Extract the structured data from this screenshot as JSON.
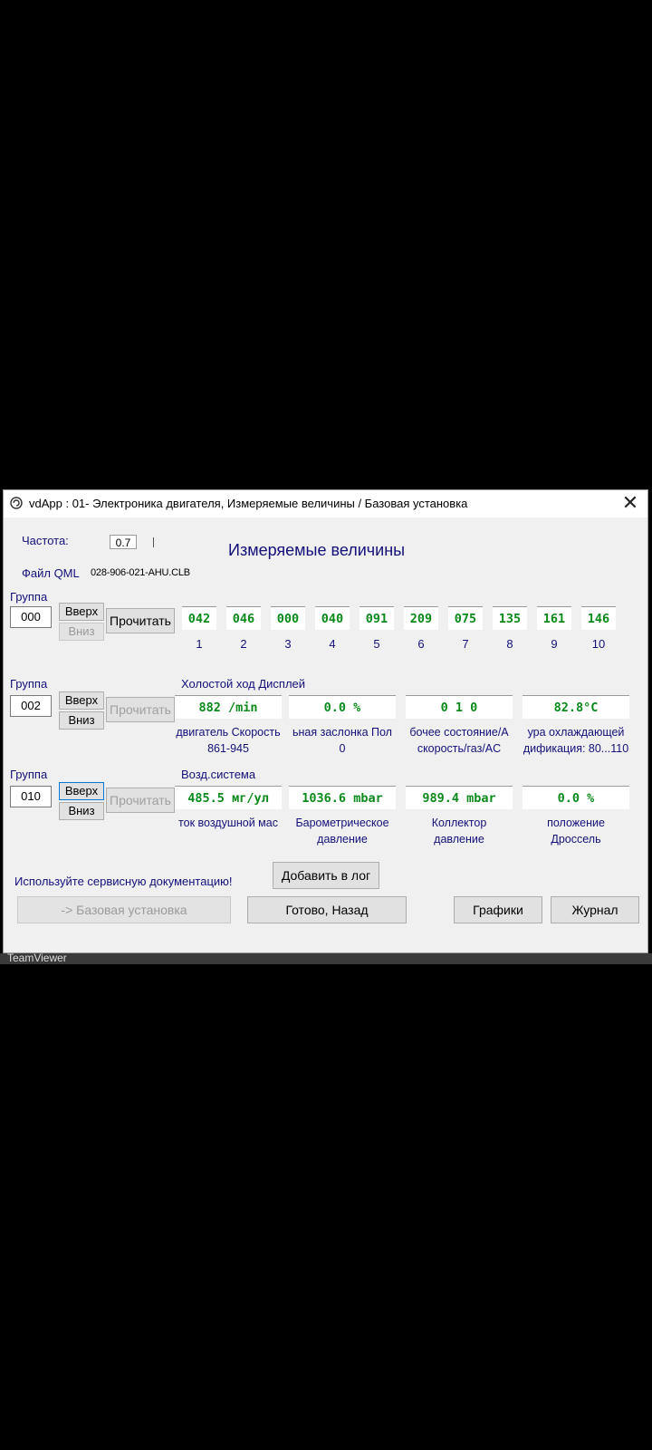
{
  "window": {
    "title": "vdApp : 01- Электроника двигателя,  Измеряемые величины / Базовая установка",
    "close": "✕"
  },
  "header": {
    "freq_label": "Частота:",
    "freq_value": "0.7",
    "title": "Измеряемые величины",
    "file_label": "Файл QML",
    "file_value": "028-906-021-AHU.CLB"
  },
  "group1": {
    "label": "Группа",
    "value": "000",
    "up": "Вверх",
    "down": "Вниз",
    "read": "Прочитать",
    "values": [
      "042",
      "046",
      "000",
      "040",
      "091",
      "209",
      "075",
      "135",
      "161",
      "146"
    ],
    "numbers": [
      "1",
      "2",
      "3",
      "4",
      "5",
      "6",
      "7",
      "8",
      "9",
      "10"
    ]
  },
  "group2": {
    "label": "Группа",
    "value": "002",
    "up": "Вверх",
    "down": "Вниз",
    "read": "Прочитать",
    "header": "Холостой ход Дисплей",
    "values": [
      "882 /min",
      "0.0 %",
      "0 1 0",
      "82.8°C"
    ],
    "desc": [
      [
        "двигатель Скорость",
        "861-945"
      ],
      [
        "ьная заслонка Пол",
        "0"
      ],
      [
        "бочее состояние/А",
        "скорость/газ/AC"
      ],
      [
        "ура охлаждающей",
        "дификация: 80...110"
      ]
    ]
  },
  "group3": {
    "label": "Группа",
    "value": "010",
    "up": "Вверх",
    "down": "Вниз",
    "read": "Прочитать",
    "header": "Возд.система",
    "values": [
      "485.5 мг/ул",
      "1036.6 mbar",
      "989.4 mbar",
      "0.0 %"
    ],
    "desc": [
      [
        "ток воздушной мас",
        ""
      ],
      [
        "Барометрическое",
        "давление"
      ],
      [
        "Коллектор",
        "давление"
      ],
      [
        "положение",
        "Дроссель"
      ]
    ]
  },
  "footer": {
    "notice": "Используйте сервисную документацию!",
    "add_log": "Добавить в лог",
    "basic": "-> Базовая установка",
    "done": "Готово, Назад",
    "graphs": "Графики",
    "journal": "Журнал"
  },
  "taskbar": {
    "label": "TeamViewer"
  }
}
